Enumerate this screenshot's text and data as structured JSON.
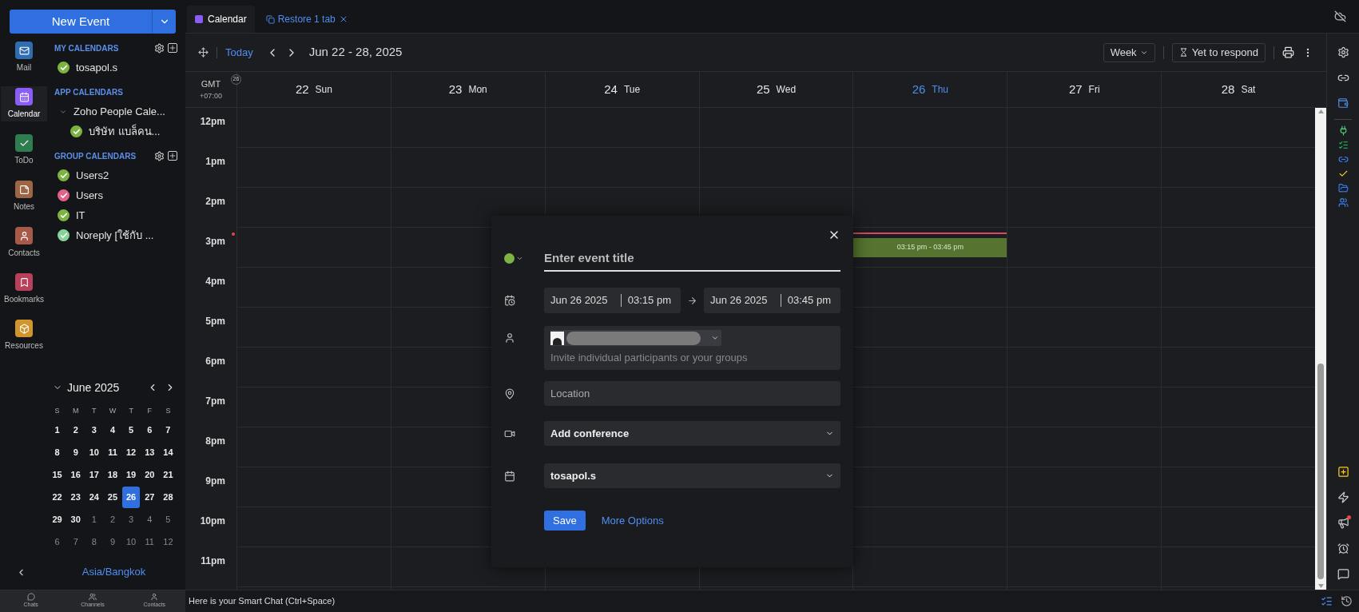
{
  "new_event": {
    "label": "New Event"
  },
  "app_nav": [
    {
      "label": "Mail",
      "selected": false,
      "color": "#2f6db0"
    },
    {
      "label": "Calendar",
      "selected": true,
      "color": "#8b5cf6"
    },
    {
      "label": "ToDo",
      "selected": false,
      "color": "#2e7d4f"
    },
    {
      "label": "Notes",
      "selected": false,
      "color": "#9c6646"
    },
    {
      "label": "Contacts",
      "selected": false,
      "color": "#a85a48"
    },
    {
      "label": "Bookmarks",
      "selected": false,
      "color": "#b8405a"
    },
    {
      "label": "Resources",
      "selected": false,
      "color": "#d0952c"
    }
  ],
  "my_calendars": {
    "heading": "MY CALENDARS",
    "items": [
      {
        "name": "tosapol.s",
        "checked": true,
        "color": "#7cb342"
      }
    ]
  },
  "app_calendars": {
    "heading": "APP CALENDARS",
    "groups": [
      {
        "name": "Zoho People Cale...",
        "expanded": true,
        "children": [
          {
            "name": "บริษัท แบล็คน...",
            "checked": true,
            "color": "#7cb342"
          }
        ]
      }
    ]
  },
  "group_calendars": {
    "heading": "GROUP CALENDARS",
    "items": [
      {
        "name": "Users2",
        "checked": true,
        "color": "#7cb342"
      },
      {
        "name": "Users",
        "checked": true,
        "color": "#e0648a"
      },
      {
        "name": "IT",
        "checked": true,
        "color": "#7cb342"
      },
      {
        "name": "Noreply [ใช้กับ ...",
        "checked": true,
        "color": "#86d49a"
      }
    ]
  },
  "mini_calendar": {
    "title": "June 2025",
    "weekdays": [
      "S",
      "M",
      "T",
      "W",
      "T",
      "F",
      "S"
    ],
    "weeks": [
      [
        {
          "day": "1",
          "in_month": true,
          "selected": false
        },
        {
          "day": "2",
          "in_month": true,
          "selected": false
        },
        {
          "day": "3",
          "in_month": true,
          "selected": false
        },
        {
          "day": "4",
          "in_month": true,
          "selected": false
        },
        {
          "day": "5",
          "in_month": true,
          "selected": false
        },
        {
          "day": "6",
          "in_month": true,
          "selected": false
        },
        {
          "day": "7",
          "in_month": true,
          "selected": false
        }
      ],
      [
        {
          "day": "8",
          "in_month": true,
          "selected": false
        },
        {
          "day": "9",
          "in_month": true,
          "selected": false
        },
        {
          "day": "10",
          "in_month": true,
          "selected": false
        },
        {
          "day": "11",
          "in_month": true,
          "selected": false
        },
        {
          "day": "12",
          "in_month": true,
          "selected": false
        },
        {
          "day": "13",
          "in_month": true,
          "selected": false
        },
        {
          "day": "14",
          "in_month": true,
          "selected": false
        }
      ],
      [
        {
          "day": "15",
          "in_month": true,
          "selected": false
        },
        {
          "day": "16",
          "in_month": true,
          "selected": false
        },
        {
          "day": "17",
          "in_month": true,
          "selected": false
        },
        {
          "day": "18",
          "in_month": true,
          "selected": false
        },
        {
          "day": "19",
          "in_month": true,
          "selected": false
        },
        {
          "day": "20",
          "in_month": true,
          "selected": false
        },
        {
          "day": "21",
          "in_month": true,
          "selected": false
        }
      ],
      [
        {
          "day": "22",
          "in_month": true,
          "selected": false
        },
        {
          "day": "23",
          "in_month": true,
          "selected": false
        },
        {
          "day": "24",
          "in_month": true,
          "selected": false
        },
        {
          "day": "25",
          "in_month": true,
          "selected": false
        },
        {
          "day": "26",
          "in_month": true,
          "selected": true
        },
        {
          "day": "27",
          "in_month": true,
          "selected": false
        },
        {
          "day": "28",
          "in_month": true,
          "selected": false
        }
      ],
      [
        {
          "day": "29",
          "in_month": true,
          "selected": false
        },
        {
          "day": "30",
          "in_month": true,
          "selected": false
        },
        {
          "day": "1",
          "in_month": false,
          "selected": false
        },
        {
          "day": "2",
          "in_month": false,
          "selected": false
        },
        {
          "day": "3",
          "in_month": false,
          "selected": false
        },
        {
          "day": "4",
          "in_month": false,
          "selected": false
        },
        {
          "day": "5",
          "in_month": false,
          "selected": false
        }
      ],
      [
        {
          "day": "6",
          "in_month": false,
          "selected": false
        },
        {
          "day": "7",
          "in_month": false,
          "selected": false
        },
        {
          "day": "8",
          "in_month": false,
          "selected": false
        },
        {
          "day": "9",
          "in_month": false,
          "selected": false
        },
        {
          "day": "10",
          "in_month": false,
          "selected": false
        },
        {
          "day": "11",
          "in_month": false,
          "selected": false
        },
        {
          "day": "12",
          "in_month": false,
          "selected": false
        }
      ]
    ]
  },
  "timezone": "Asia/Bangkok",
  "tab": {
    "label": "Calendar"
  },
  "restore_link": "Restore 1 tab",
  "toolbar": {
    "today": "Today",
    "range": "Jun 22 - 28, 2025",
    "view": "Week",
    "rsvp": "Yet to respond"
  },
  "gmt": {
    "label": "GMT",
    "offset": "+07:00",
    "week_number": "26"
  },
  "days": [
    {
      "date": "22",
      "name": "Sun",
      "today": false
    },
    {
      "date": "23",
      "name": "Mon",
      "today": false
    },
    {
      "date": "24",
      "name": "Tue",
      "today": false
    },
    {
      "date": "25",
      "name": "Wed",
      "today": false
    },
    {
      "date": "26",
      "name": "Thu",
      "today": true,
      "events": [
        {
          "time": "03:15 pm - 03:45 pm",
          "color": "#56742f"
        }
      ]
    },
    {
      "date": "27",
      "name": "Fri",
      "today": false
    },
    {
      "date": "28",
      "name": "Sat",
      "today": false
    }
  ],
  "hours": [
    "12pm",
    "1pm",
    "2pm",
    "3pm",
    "4pm",
    "5pm",
    "6pm",
    "7pm",
    "8pm",
    "9pm",
    "10pm",
    "11pm"
  ],
  "dialog": {
    "color": "#7cb342",
    "title_placeholder": "Enter event title",
    "start_date": "Jun 26 2025",
    "start_time": "03:15 pm",
    "end_date": "Jun 26 2025",
    "end_time": "03:45 pm",
    "participants_placeholder": "Invite individual participants or your groups",
    "location_placeholder": "Location",
    "conference": "Add conference",
    "calendar": "tosapol.s",
    "save": "Save",
    "more_options": "More Options"
  },
  "chat_bar": {
    "placeholder": "Here is your Smart Chat (Ctrl+Space)"
  },
  "bottom_nav": [
    "Chats",
    "Channels",
    "Contacts"
  ]
}
